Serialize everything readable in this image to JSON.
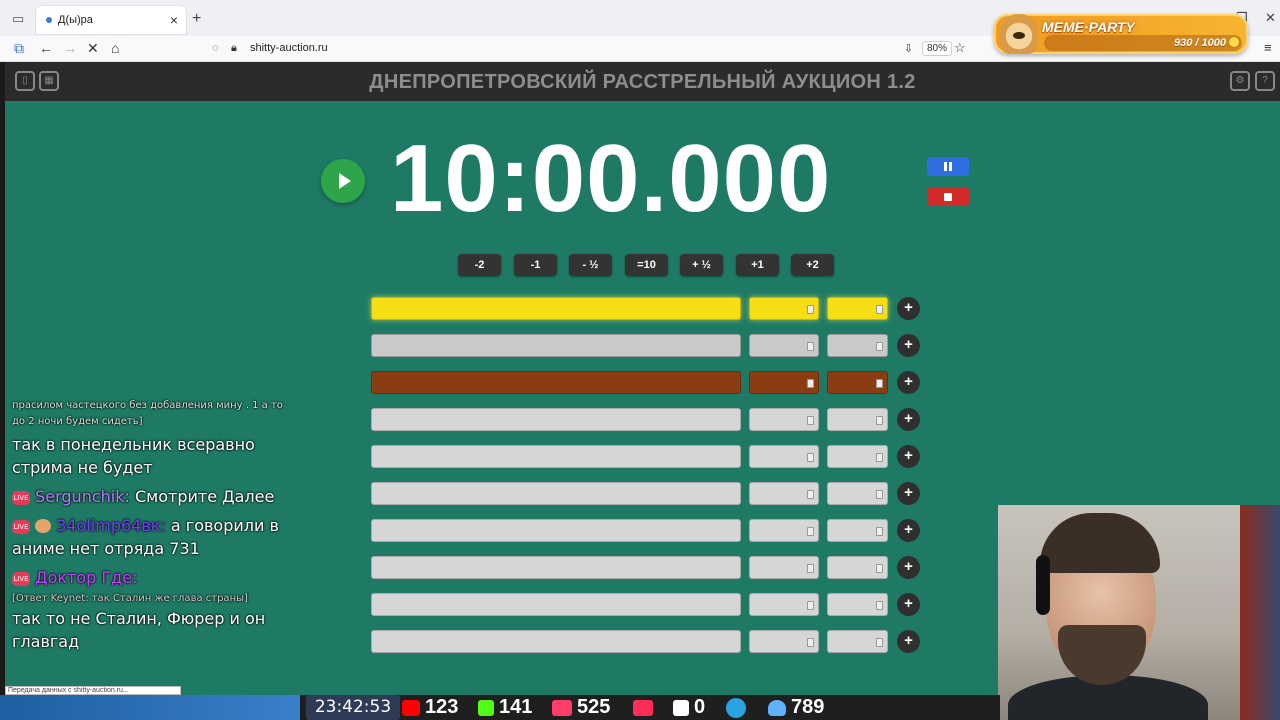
{
  "browser": {
    "tab_title": "Д(ы)ра",
    "url": "shitty-auction.ru",
    "zoom": "80%"
  },
  "overlay": {
    "meme_party_title": "MEME·PARTY",
    "meme_party_score": "930 / 1000"
  },
  "app": {
    "title": "ДНЕПРОПЕТРОВСКИЙ РАССТРЕЛЬНЫЙ АУКЦИОН 1.2",
    "timer": "10:00.000",
    "adjust_buttons": [
      "-2",
      "-1",
      "- ½",
      "=10",
      "+ ½",
      "+1",
      "+2"
    ],
    "rows": [
      {
        "tier": "gold"
      },
      {
        "tier": "silver"
      },
      {
        "tier": "bronze"
      },
      {
        "tier": "plain"
      },
      {
        "tier": "plain"
      },
      {
        "tier": "plain"
      },
      {
        "tier": "plain"
      },
      {
        "tier": "plain"
      },
      {
        "tier": "plain"
      },
      {
        "tier": "plain"
      }
    ],
    "add_label": "+"
  },
  "chat": {
    "faded_line1": "прасилом частецкого без добавления мину . 1 а то",
    "faded_line2": "до 2 ночи будем сидеть]",
    "msg1": "так в понедельник всеравно стрима не будет",
    "user2": "Sergunchik:",
    "msg2": "Смотрите Далее",
    "user3": "34olimp64вк:",
    "msg3": "а говорили в аниме нет отряда 731",
    "user4": "Доктор Где:",
    "reply4": "[Ответ Keynet: так Сталин же глава страны]",
    "msg4": "так то не Сталин, Фюрер и он главгад",
    "live_badge": "LIVE"
  },
  "status": {
    "loading_text": "Передача данных с shitty-auction.ru...",
    "time": "23:42:53",
    "youtube": "123",
    "kick": "141",
    "vklive": "525",
    "twitch_like": "",
    "rumble": "0",
    "viewers": "789"
  },
  "colors": {
    "app_bg": "#1e7a64",
    "header_bg": "#2b2b2b",
    "gold": "#f5df14",
    "silver": "#c9c9c9",
    "bronze": "#8a3c12",
    "play": "#2ea54a",
    "pause": "#2f6ee0",
    "stop": "#d32a2a"
  }
}
